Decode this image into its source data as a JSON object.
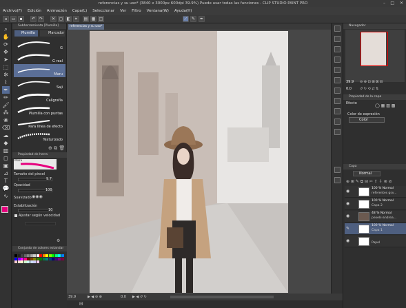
{
  "window": {
    "title": "referencias y su uso* (3840 x 3000px 600dpi 39.9%)  Puede usar todas las funciones - CLIP STUDIO PAINT PRO"
  },
  "menu": [
    "Archivo(F)",
    "Edición",
    "Animación",
    "Capa(L)",
    "Seleccionar",
    "Ver",
    "Filtro",
    "Ventana(W)",
    "Ayuda(H)"
  ],
  "subtool": {
    "header": "Subherramienta [Plumilla]",
    "tabs": [
      "Plumilla",
      "Marcador"
    ],
    "brushes": [
      "G",
      "G real",
      "Maru",
      "Saji",
      "Caligrafía",
      "Plumilla con puntas",
      "Para línea de efecto",
      "Texturizado"
    ],
    "selected_index": 2
  },
  "tool_property": {
    "header": "Propiedad de herra",
    "preview_label": "Maru",
    "brush_size_label": "Tamaño del pincel",
    "brush_size_value": "9.7",
    "opacity_label": "Opacidad",
    "opacity_value": "100",
    "smoothing_label": "Suavizado",
    "stabilization_label": "Estabilización",
    "stabilization_value": "10",
    "speed_label": "Ajustar según velocidad"
  },
  "color_set": {
    "header": "Conjunto de colores estandar",
    "accent": "#e6007e"
  },
  "document": {
    "tab_label": "referencias y su uso*"
  },
  "status": {
    "zoom": "39.9",
    "angle": "0.0"
  },
  "navigator": {
    "header": "Navegador",
    "zoom": "39.9",
    "angle": "0.0"
  },
  "layer_property": {
    "header": "Propiedad de la capa",
    "effect_label": "Efecto",
    "expression_label": "Color de expresión",
    "expression_value": "Color"
  },
  "layers": {
    "header": "Capa",
    "blend_mode": "Normal",
    "items": [
      {
        "line1": "100 % Normal",
        "line2": "referentes gsv...",
        "selected": false
      },
      {
        "line1": "100 % Normal",
        "line2": "Capa 2",
        "selected": false
      },
      {
        "line1": "48 % Normal",
        "line2": "pexels-andrea...",
        "selected": false
      },
      {
        "line1": "100 % Normal",
        "line2": "Capa 1",
        "selected": true
      },
      {
        "line1": "",
        "line2": "Papel",
        "selected": false
      }
    ]
  },
  "palette": [
    "#000000",
    "#222222",
    "#444444",
    "#666666",
    "#888888",
    "#aaaaaa",
    "#cccccc",
    "#ffffff",
    "#ff0000",
    "#ff8000",
    "#ffff00",
    "#80ff00",
    "#00ff00",
    "#00ff80",
    "#00ffff",
    "#0080ff",
    "#0000ff",
    "#8000ff",
    "#ff00ff",
    "#ff0080",
    "#800000",
    "#804000",
    "#808000",
    "#408000",
    "#008000",
    "#008040",
    "#008080",
    "#004080",
    "#000080",
    "#400080",
    "#800080",
    "#800040",
    "#ffcccc",
    "#ffe0cc",
    "#ffffcc",
    "#ccffcc",
    "#ccffff",
    "#cce0ff",
    "#ccccff",
    "#ffccff"
  ]
}
